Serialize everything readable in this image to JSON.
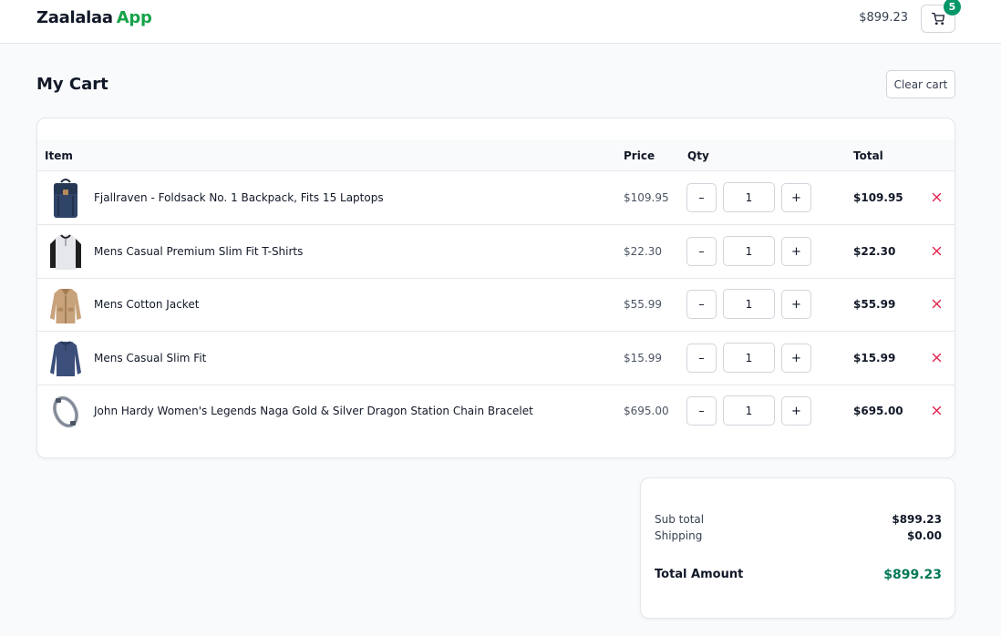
{
  "app": {
    "name_part1": "Zaalalaa",
    "name_part2": "App"
  },
  "header": {
    "cart_total": "$899.23",
    "cart_count": "5",
    "cart_icon": "cart-icon"
  },
  "page": {
    "title": "My Cart",
    "clear_label": "Clear cart"
  },
  "table": {
    "columns": {
      "item": "Item",
      "price": "Price",
      "qty": "Qty",
      "total": "Total"
    },
    "rows": [
      {
        "name": "Fjallraven - Foldsack No. 1 Backpack, Fits 15 Laptops",
        "price": "$109.95",
        "qty": "1",
        "total": "$109.95",
        "image_icon": "backpack-image"
      },
      {
        "name": "Mens Casual Premium Slim Fit T-Shirts",
        "price": "$22.30",
        "qty": "1",
        "total": "$22.30",
        "image_icon": "tshirt-image"
      },
      {
        "name": "Mens Cotton Jacket",
        "price": "$55.99",
        "qty": "1",
        "total": "$55.99",
        "image_icon": "jacket-image"
      },
      {
        "name": "Mens Casual Slim Fit",
        "price": "$15.99",
        "qty": "1",
        "total": "$15.99",
        "image_icon": "longsleeve-image"
      },
      {
        "name": "John Hardy Women's Legends Naga Gold & Silver Dragon Station Chain Bracelet",
        "price": "$695.00",
        "qty": "1",
        "total": "$695.00",
        "image_icon": "bracelet-image"
      }
    ],
    "minus_label": "–",
    "plus_label": "+"
  },
  "summary": {
    "subtotal_label": "Sub total",
    "subtotal_value": "$899.23",
    "shipping_label": "Shipping",
    "shipping_value": "$0.00",
    "total_label": "Total Amount",
    "total_value": "$899.23"
  },
  "colors": {
    "brand_accent": "#16a34a",
    "badge": "#059669",
    "remove": "#e11d48",
    "total_amount": "#047857"
  }
}
